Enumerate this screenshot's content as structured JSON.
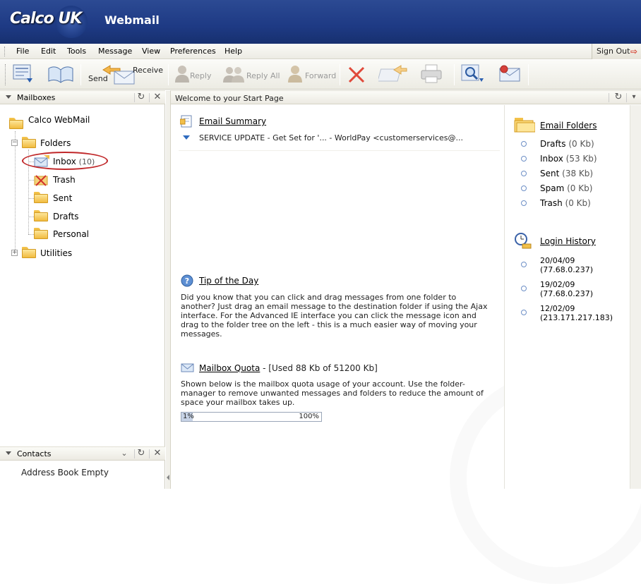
{
  "header": {
    "logo": "Calco UK",
    "product": "Webmail"
  },
  "menu": {
    "items": [
      "File",
      "Edit",
      "Tools",
      "Message",
      "View",
      "Preferences",
      "Help"
    ],
    "signout": "Sign Out"
  },
  "toolbar": {
    "send_label": "Send",
    "receive_label": "Receive",
    "reply_label": "Reply",
    "reply_all_label": "Reply All",
    "forward_label": "Forward"
  },
  "mailboxes": {
    "title": "Mailboxes",
    "root": "Calco WebMail",
    "folders_label": "Folders",
    "items": [
      {
        "label": "Inbox",
        "count": "(10)"
      },
      {
        "label": "Trash"
      },
      {
        "label": "Sent"
      },
      {
        "label": "Drafts"
      },
      {
        "label": "Personal"
      }
    ],
    "utilities_label": "Utilities"
  },
  "contacts": {
    "title": "Contacts",
    "empty": "Address Book Empty"
  },
  "start": {
    "title": "Welcome to your Start Page",
    "email_summary": "Email Summary",
    "summary_line": "SERVICE UPDATE - Get Set for '... - WorldPay <customerservices@...",
    "tip_title": "Tip of the Day",
    "tip_lines": [
      "Did you know that you can click and drag messages from one folder to",
      "another? Just drag an email message to the destination folder if using the Ajax",
      "interface. For the Advanced IE interface you can click the message icon and",
      "drag to the folder tree on the left - this is a much easier way of moving your",
      "messages."
    ],
    "quota_title": "Mailbox Quota",
    "quota_detail": " - [Used 88 Kb of 51200 Kb]",
    "quota_lines": [
      "Shown below is the mailbox quota usage of your account. Use the folder-",
      "manager to remove unwanted messages and folders to reduce the amount of",
      "space your mailbox takes up."
    ],
    "quota_used_label": "1%",
    "quota_total_label": "100%",
    "quota_fraction": 0.01
  },
  "email_folders": {
    "title": "Email Folders",
    "items": [
      {
        "name": "Drafts",
        "size": "(0 Kb)"
      },
      {
        "name": "Inbox",
        "size": "(53 Kb)"
      },
      {
        "name": "Sent",
        "size": "(38 Kb)"
      },
      {
        "name": "Spam",
        "size": "(0 Kb)"
      },
      {
        "name": "Trash",
        "size": "(0 Kb)"
      }
    ]
  },
  "login_history": {
    "title": "Login History",
    "items": [
      {
        "date": "20/04/09",
        "ip": "(77.68.0.237)"
      },
      {
        "date": "19/02/09",
        "ip": "(77.68.0.237)"
      },
      {
        "date": "12/02/09",
        "ip": "(213.171.217.183)"
      }
    ]
  },
  "colors": {
    "header_bg": "#1e3a84",
    "highlight_ring": "#c0282a",
    "folder": "#f1bb3f",
    "quota_fill": "#c7d3e6"
  }
}
